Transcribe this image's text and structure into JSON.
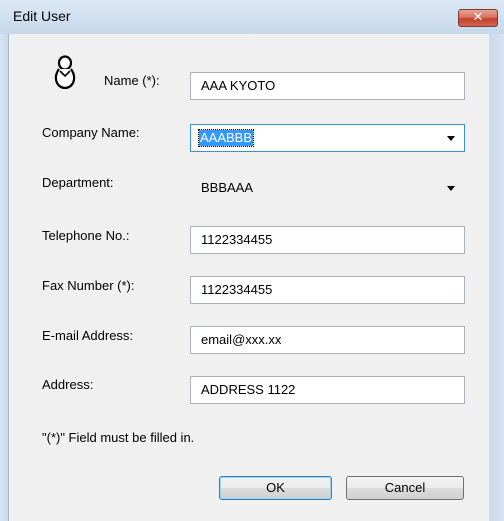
{
  "window": {
    "title": "Edit User",
    "close_glyph": "✕"
  },
  "form": {
    "name_label": "Name (*):",
    "name_value": "AAA KYOTO",
    "company_label": "Company Name:",
    "company_value": "AAABBB",
    "department_label": "Department:",
    "department_value": "BBBAAA",
    "telephone_label": "Telephone No.:",
    "telephone_value": "1122334455",
    "fax_label": "Fax Number (*):",
    "fax_value": "1122334455",
    "email_label": "E-mail Address:",
    "email_value": "email@xxx.xx",
    "address_label": "Address:",
    "address_value": "ADDRESS 1122",
    "note": "\"(*)\" Field must be filled in."
  },
  "buttons": {
    "ok": "OK",
    "cancel": "Cancel"
  },
  "icons": {
    "user": "user-icon",
    "dropdown_arrow": "chevron-down-icon",
    "close": "close-icon"
  },
  "colors": {
    "selection": "#3399ff",
    "titlebar": "#c9daec",
    "close_button": "#c2402b"
  }
}
